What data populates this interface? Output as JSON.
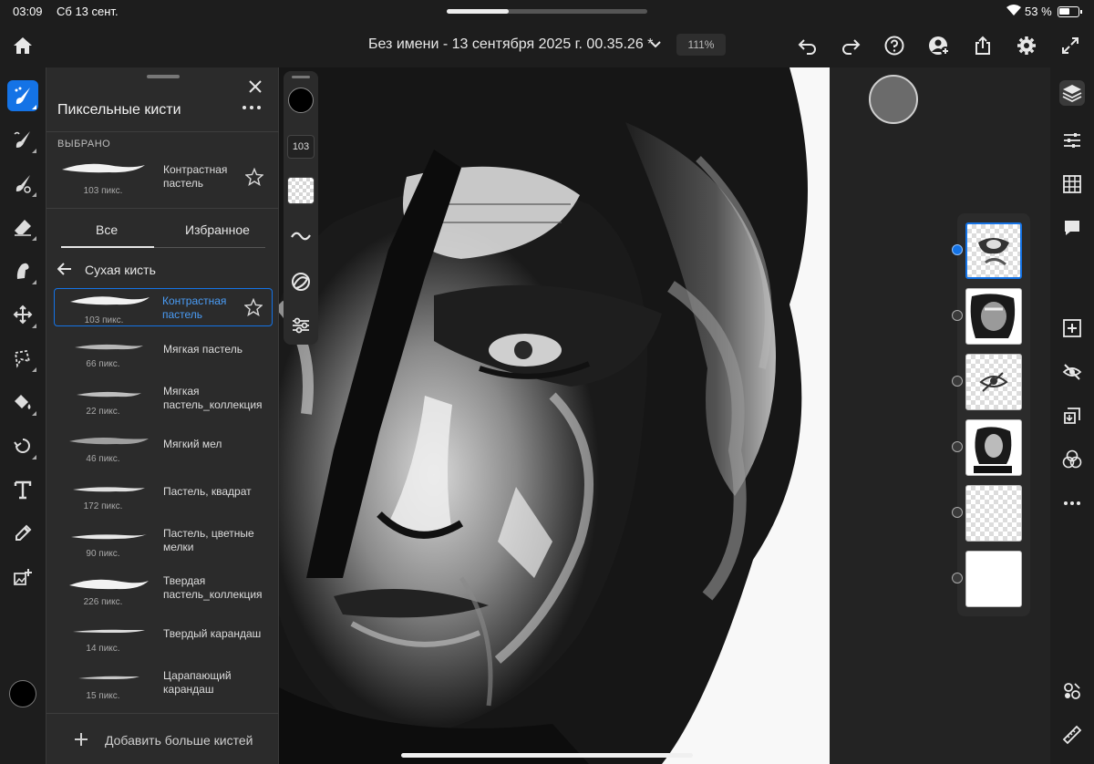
{
  "status_bar": {
    "time": "03:09",
    "date": "Сб 13 сент.",
    "battery": "53 %"
  },
  "top_bar": {
    "document_title": "Без имени - 13 сентября 2025 г. 00.35.26 *",
    "zoom": "111%",
    "icons": [
      "home-icon",
      "chevron-down-icon",
      "undo-icon",
      "redo-icon",
      "help-icon",
      "invite-icon",
      "share-icon",
      "settings-icon",
      "fullscreen-icon"
    ]
  },
  "tool_rail": {
    "tools": [
      "pixel-brush-icon",
      "live-brush-icon",
      "vector-brush-icon",
      "eraser-icon",
      "smudge-icon",
      "transform-icon",
      "lasso-icon",
      "fill-icon",
      "liquify-icon",
      "text-icon",
      "eyedropper-icon",
      "place-image-icon"
    ],
    "active_tool": "pixel-brush-icon",
    "color": "#000000"
  },
  "brush_panel": {
    "title": "Пиксельные кисти",
    "selected_section": "ВЫБРАНО",
    "selected_brush": {
      "name": "Контрастная пастель",
      "size": "103 пикс."
    },
    "tabs": [
      "Все",
      "Избранное"
    ],
    "active_tab": "Все",
    "category": "Сухая кисть",
    "brushes": [
      {
        "name": "Контрастная пастель",
        "size": "103 пикс.",
        "selected": true
      },
      {
        "name": "Мягкая пастель",
        "size": "66 пикс."
      },
      {
        "name": "Мягкая пастель_коллекция",
        "size": "22 пикс."
      },
      {
        "name": "Мягкий мел",
        "size": "46 пикс."
      },
      {
        "name": "Пастель, квадрат",
        "size": "172 пикс."
      },
      {
        "name": "Пастель, цветные мелки",
        "size": "90 пикс."
      },
      {
        "name": "Твердая пастель_коллекция",
        "size": "226 пикс."
      },
      {
        "name": "Твердый карандаш",
        "size": "14 пикс."
      },
      {
        "name": "Царапающий карандаш",
        "size": "15 пикс."
      }
    ],
    "add_more": "Добавить больше кистей"
  },
  "brush_settings": {
    "size": "103",
    "icons": [
      "color-icon",
      "size-icon",
      "opacity-icon",
      "smoothing-icon",
      "pressure-icon",
      "brush-settings-icon"
    ]
  },
  "layers": {
    "count": 6,
    "selected_index": 0
  },
  "right_rail": {
    "icons": [
      "layers-icon",
      "layer-properties-icon",
      "grid-icon",
      "comments-icon",
      "add-layer-icon",
      "hide-layer-icon",
      "merge-down-icon",
      "blend-icon",
      "more-icon",
      "assets-icon",
      "ruler-icon"
    ],
    "active": "layers-icon"
  },
  "colors": {
    "accent": "#1473e6",
    "background": "#1d1d1d",
    "panel": "#2b2b2b"
  }
}
